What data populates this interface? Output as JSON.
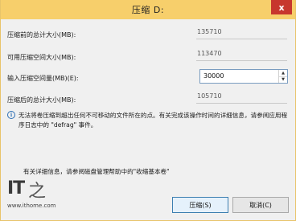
{
  "window": {
    "title": "压缩 D:",
    "close_glyph": "x"
  },
  "fields": {
    "total_before_label": "压缩前的总计大小(MB):",
    "total_before_value": "135710",
    "available_label": "可用压缩空间大小(MB):",
    "available_value": "113470",
    "input_label": "输入压缩空间量(MB)(E):",
    "input_value": "30000",
    "total_after_label": "压缩后的总计大小(MB):",
    "total_after_value": "105710"
  },
  "info": {
    "icon": "info-icon",
    "text": "无法将卷压缩到超出任何不可移动的文件所在的点。有关完成该操作时间的详细信息，请参阅应用程序日志中的 \"defrag\" 事件。"
  },
  "more_info": {
    "text": "有关详细信息，请参阅磁盘管理帮助中的\"收缩基本卷\""
  },
  "watermark": {
    "logo_a": "IT",
    "logo_b": "之",
    "url": "www.ithome.com"
  },
  "buttons": {
    "shrink": "压缩(S)",
    "cancel": "取消(C)"
  }
}
